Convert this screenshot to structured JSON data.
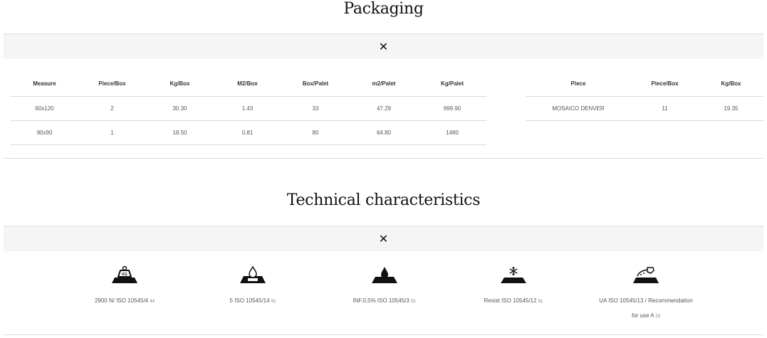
{
  "packaging": {
    "title": "Packaging",
    "close_glyph": "✕",
    "main_table": {
      "headers": [
        "Measure",
        "Piece/Box",
        "Kg/Box",
        "M2/Box",
        "Box/Palet",
        "m2/Palet",
        "Kg/Palet"
      ],
      "rows": [
        [
          "60x120",
          "2",
          "30.30",
          "1.43",
          "33",
          "47.29",
          "999.90"
        ],
        [
          "90x90",
          "1",
          "18.50",
          "0.81",
          "80",
          "64.80",
          "1480"
        ]
      ]
    },
    "piece_table": {
      "headers": [
        "Piece",
        "Piece/Box",
        "Kg/Box"
      ],
      "rows": [
        [
          "MOSAICO DENVER",
          "11",
          "19.35"
        ]
      ]
    }
  },
  "technical": {
    "title": "Technical characteristics",
    "close_glyph": "✕",
    "items": [
      {
        "icon": "weight-kg-icon",
        "label": "2900 N/ ISO 10545/4",
        "sub": "44",
        "label_line2": ""
      },
      {
        "icon": "water-absorption-icon",
        "label": "5 ISO 10545/14",
        "sub": "51",
        "label_line2": ""
      },
      {
        "icon": "drop-icon",
        "label": "INF.0,5% ISO 10545/3",
        "sub": "51",
        "label_line2": ""
      },
      {
        "icon": "snowflake-frost-icon",
        "label": "Resist ISO 10545/12",
        "sub": "51",
        "label_line2": ""
      },
      {
        "icon": "chemical-resistance-icon",
        "label": "UA ISO 10545/13 / Recommendation",
        "sub": "23",
        "label_line2": "for use A"
      }
    ]
  }
}
